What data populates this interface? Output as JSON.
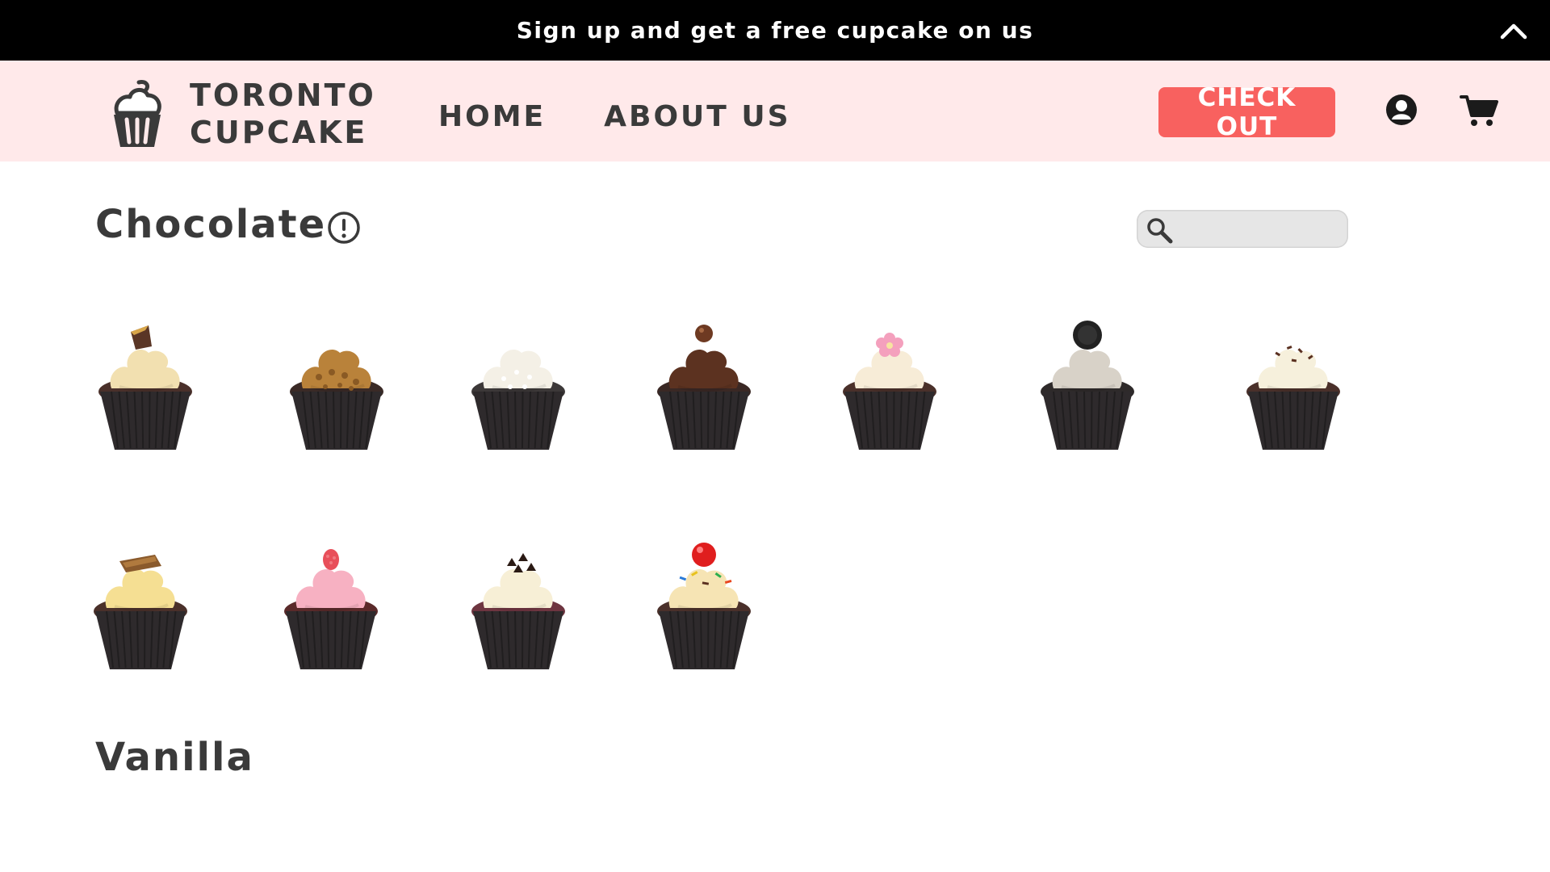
{
  "promo": {
    "text": "Sign up and get a free cupcake on us"
  },
  "brand": {
    "line1": "TORONTO",
    "line2": "CUPCAKE"
  },
  "nav": {
    "home": "HOME",
    "about": "ABOUT US"
  },
  "header": {
    "checkout_label": "CHECK OUT"
  },
  "search": {
    "placeholder": "",
    "value": ""
  },
  "sections": {
    "chocolate": "Chocolate",
    "vanilla": "Vanilla"
  },
  "icons": {
    "collapse": "chevron-up-icon",
    "logo": "cupcake-logo-icon",
    "account": "user-icon",
    "cart": "cart-icon",
    "info": "info-icon",
    "search": "search-icon"
  },
  "colors": {
    "promo_bg": "#000000",
    "header_bg": "#ffe9ea",
    "accent": "#f8615f",
    "text": "#3a3a3a",
    "search_bg": "#e6e6e6"
  },
  "cupcakes": [
    {
      "frosting": "#f2e0b0",
      "cake": "#4a302a",
      "topping": "chocolate-wedge"
    },
    {
      "frosting": "#b9823a",
      "cake": "#3a2a26",
      "topping": "crumble"
    },
    {
      "frosting": "#f4f0e6",
      "cake": "#3c3838",
      "topping": "coconut"
    },
    {
      "frosting": "#5c3220",
      "cake": "#3a2824",
      "topping": "truffle"
    },
    {
      "frosting": "#f7ecd7",
      "cake": "#4a302a",
      "topping": "pink-flower"
    },
    {
      "frosting": "#d8d2c8",
      "cake": "#2e2a2a",
      "topping": "cookie"
    },
    {
      "frosting": "#f6f0dc",
      "cake": "#4a302a",
      "topping": "sprinkles"
    },
    {
      "frosting": "#f5df93",
      "cake": "#4a302a",
      "topping": "toffee"
    },
    {
      "frosting": "#f7b1c2",
      "cake": "#5a2a2a",
      "topping": "raspberry"
    },
    {
      "frosting": "#f7efd6",
      "cake": "#6e3540",
      "topping": "chocolate-chips"
    },
    {
      "frosting": "#f6e4b4",
      "cake": "#4a302a",
      "topping": "cherry-sprinkles"
    }
  ]
}
